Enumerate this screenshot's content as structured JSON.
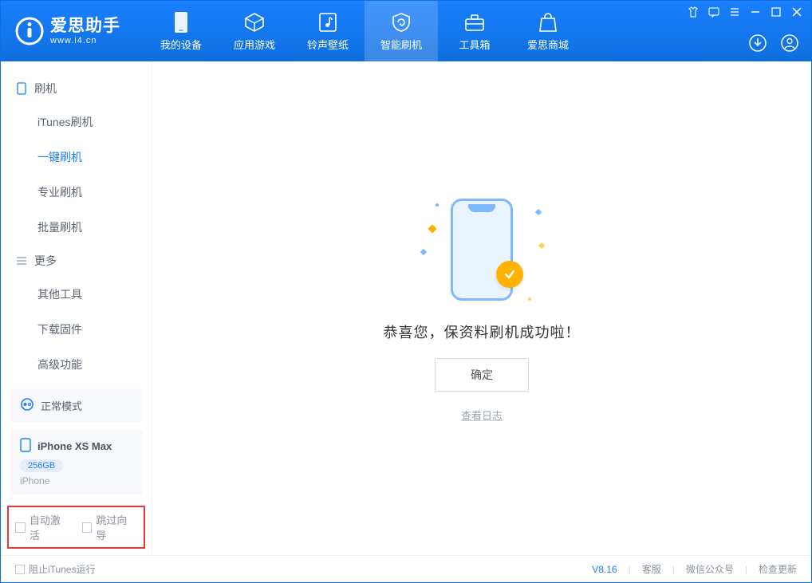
{
  "app": {
    "title": "爱思助手",
    "subtitle": "www.i4.cn"
  },
  "nav": {
    "items": [
      {
        "label": "我的设备"
      },
      {
        "label": "应用游戏"
      },
      {
        "label": "铃声壁纸"
      },
      {
        "label": "智能刷机"
      },
      {
        "label": "工具箱"
      },
      {
        "label": "爱思商城"
      }
    ],
    "active_index": 3
  },
  "sidebar": {
    "groups": [
      {
        "header": "刷机",
        "items": [
          {
            "label": "iTunes刷机"
          },
          {
            "label": "一键刷机",
            "active": true
          },
          {
            "label": "专业刷机"
          },
          {
            "label": "批量刷机"
          }
        ]
      },
      {
        "header": "更多",
        "items": [
          {
            "label": "其他工具"
          },
          {
            "label": "下载固件"
          },
          {
            "label": "高级功能"
          }
        ]
      }
    ]
  },
  "device": {
    "mode_label": "正常模式",
    "name": "iPhone XS Max",
    "capacity": "256GB",
    "type": "iPhone"
  },
  "options": {
    "auto_activate": "自动激活",
    "skip_wizard": "跳过向导"
  },
  "main": {
    "success_message": "恭喜您，保资料刷机成功啦！",
    "ok_button": "确定",
    "view_log": "查看日志"
  },
  "footer": {
    "block_itunes": "阻止iTunes运行",
    "version": "V8.16",
    "links": {
      "support": "客服",
      "wechat": "微信公众号",
      "check_update": "检查更新"
    }
  }
}
